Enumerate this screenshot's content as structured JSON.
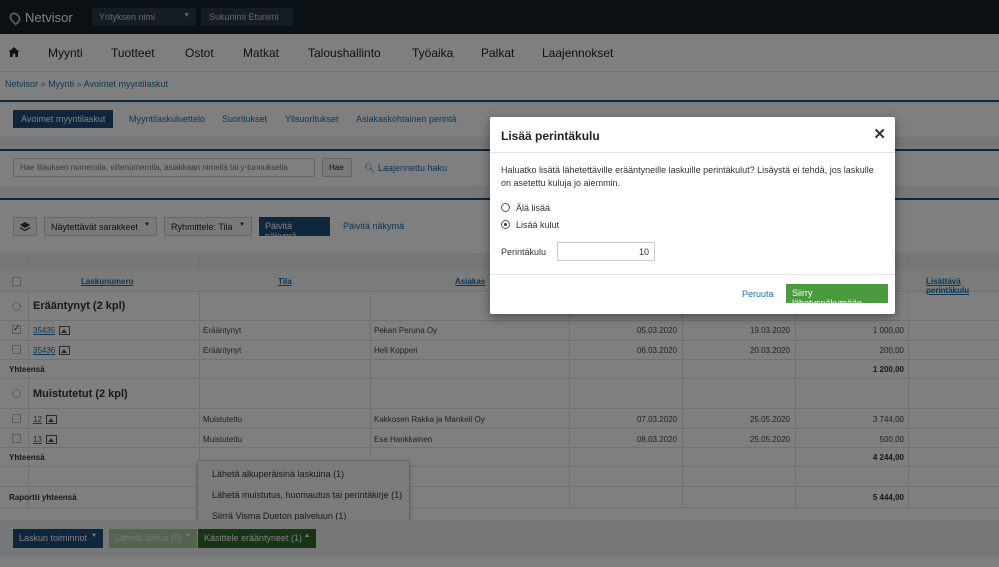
{
  "topbar": {
    "logo_text": "Netvisor",
    "company_select": "Yrityksen nimi",
    "user_name": "Sukunimi Etunimi"
  },
  "mainnav": {
    "items": [
      "Myynti",
      "Tuotteet",
      "Ostot",
      "Matkat",
      "Taloushallinto",
      "Työaika",
      "Palkat",
      "Laajennokset"
    ]
  },
  "breadcrumb": {
    "items": [
      "Netvisor",
      "Myynti",
      "Avoimet myyntilaskut"
    ],
    "separator": "»"
  },
  "tabs": {
    "active": "Avoimet myyntilaskut",
    "items": [
      "Myyntilaskuluettelo",
      "Suoritukset",
      "Ylisuoritukset",
      "Asiakaskohtainen perintä"
    ]
  },
  "search": {
    "placeholder": "Hae tilauksen numerolla, viitenumerolla, asiakkaan nimellä tai y-tunnuksella",
    "button": "Hae",
    "advanced": "Laajennettu haku"
  },
  "toolbar": {
    "columns_btn": "Näytettävät sarakkeet",
    "group_btn": "Ryhmittele: Tila",
    "refresh_btn": "Päivitä näkymä",
    "refresh_link": "Päivitä näkymä"
  },
  "table": {
    "headers": {
      "number": "Laskunumero",
      "status": "Tila",
      "customer": "Asiakas",
      "extra_fee": "Lisättävä perintäkulu"
    },
    "groups": [
      {
        "title": "Erääntynyt (2 kpl)",
        "rows": [
          {
            "number": "35435",
            "status": "Erääntynyt",
            "customer": "Pekan Peruna Oy",
            "date": "05.03.2020",
            "due": "19.03.2020",
            "amount": "1 000,00",
            "checked": true
          },
          {
            "number": "35436",
            "status": "Erääntynyt",
            "customer": "Heli Kopperi",
            "date": "06.03.2020",
            "due": "20.03.2020",
            "amount": "200,00",
            "checked": false
          }
        ],
        "total_label": "Yhteensä",
        "total": "1 200,00"
      },
      {
        "title": "Muistutetut (2 kpl)",
        "rows": [
          {
            "number": "12",
            "status": "Muistutettu",
            "customer": "Kakkosen Rakka ja Mankeli Oy",
            "date": "07.03.2020",
            "due": "25.05.2020",
            "amount": "3 744,00",
            "checked": false
          },
          {
            "number": "13",
            "status": "Muistutettu",
            "customer": "Esa Hankkainen",
            "date": "08.03.2020",
            "due": "25.05.2020",
            "amount": "500,00",
            "checked": false
          }
        ],
        "total_label": "Yhteensä",
        "total": "4 244,00"
      }
    ],
    "report_total_label": "Raportti yhteensä",
    "report_total": "5 444,00"
  },
  "context_menu": {
    "items": [
      "Lähetä alkuperäisinä laskuina (1)",
      "Lähetä muistutus, huomautus tai perintäkirje (1)",
      "Siirrä Visma Dueton palveluun (1)"
    ]
  },
  "bottom_bar": {
    "invoice_actions": "Laskun toiminnot",
    "send_invoices": "Lähetä laskut (0)",
    "handle_overdue": "Käsittele erääntyneet (1)"
  },
  "modal": {
    "title": "Lisää perintäkulu",
    "description": "Haluatko lisätä lähetettäville erääntyneille laskuille perintäkulut? Lisäystä ei tehdä, jos laskulle on asetettu kuluja jo aiemmin.",
    "option_no": "Älä lisää",
    "option_yes": "Lisää kulut",
    "selected": "Lisää kulut",
    "fee_label": "Perintäkulu",
    "fee_value": "10",
    "cancel": "Peruuta",
    "proceed": "Siirry lähetysnäkymään"
  },
  "colors": {
    "topbar": "#17212b",
    "primary": "#1f4f79",
    "green": "#4c9a3f",
    "link": "#1b6fa8"
  }
}
